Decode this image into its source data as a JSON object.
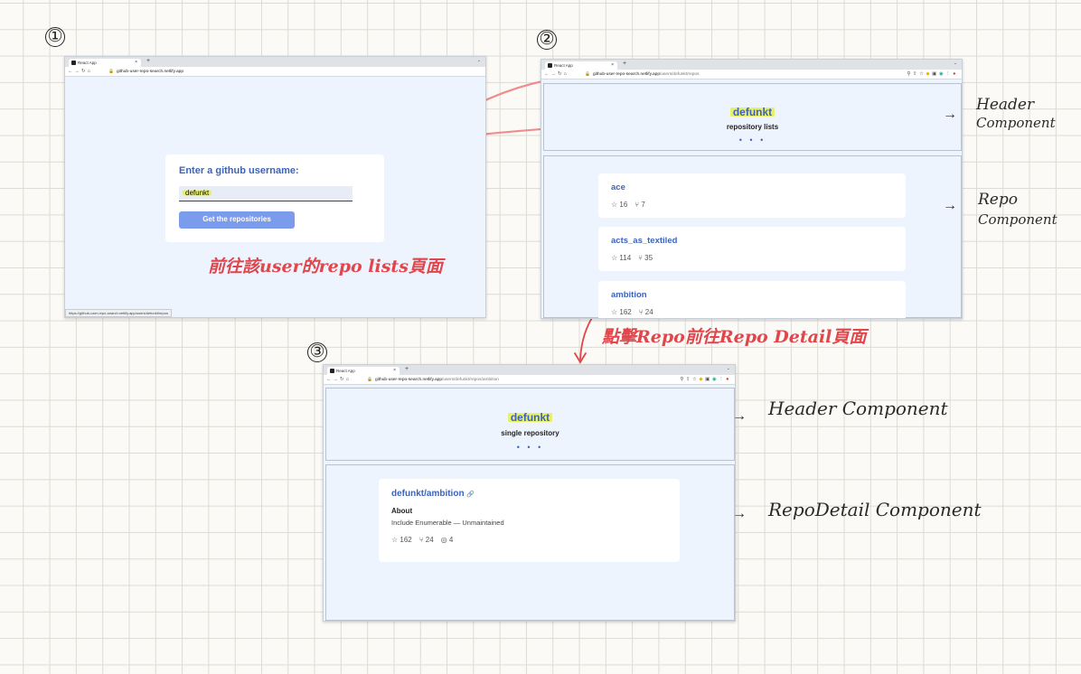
{
  "steps": [
    "①",
    "②",
    "③"
  ],
  "browser": {
    "tab_title": "React App",
    "tab_close": "×",
    "tab_new": "+",
    "tab_chevron": "⌄",
    "nav": [
      "←",
      "→",
      "↻",
      "⌂"
    ],
    "url_host": "github-user-repo-search.netlify.app",
    "url_path_2": "/users/defunkt/repos",
    "url_path_3": "/users/defunkt/repos/ambition"
  },
  "screen1": {
    "prompt": "Enter a github username:",
    "input_value": "defunkt",
    "submit_label": "Get the repositories",
    "status_url": "https://github-user-repo-search.netlify.app/users/defunkt/repos"
  },
  "screen2": {
    "username": "defunkt",
    "subtitle": "repository lists",
    "dots": "• • •",
    "repos": [
      {
        "name": "ace",
        "stars": "☆ 16",
        "forks": "⑂ 7"
      },
      {
        "name": "acts_as_textiled",
        "stars": "☆ 114",
        "forks": "⑂ 35"
      },
      {
        "name": "ambition",
        "stars": "☆ 162",
        "forks": "⑂ 24"
      }
    ]
  },
  "screen3": {
    "username": "defunkt",
    "subtitle": "single repository",
    "dots": "• • •",
    "repo_full_name": "defunkt/ambition",
    "link_icon": "🔗",
    "about_heading": "About",
    "about_text": "Include Enumerable — Unmaintained",
    "stars": "☆ 162",
    "forks": "⑂ 24",
    "watchers": "◎ 4"
  },
  "annotations": {
    "arrow": "→",
    "header1": [
      "Header",
      "Component"
    ],
    "repo": [
      "Repo",
      "Component"
    ],
    "header2": "Header Component",
    "detail": "RepoDetail Component",
    "note1": "前往該user的repo lists頁面",
    "note2": "點擊Repo前往Repo Detail頁面"
  },
  "colors": {
    "accent": "#3d63b9",
    "button": "#7b9bec",
    "highlight": "#e8ef6d",
    "annotation_red": "#e0464b",
    "page_bg": "#eef4fe"
  }
}
